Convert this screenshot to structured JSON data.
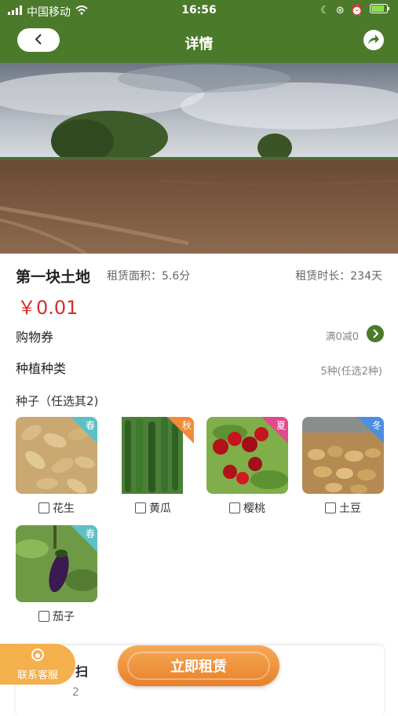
{
  "status_bar": {
    "carrier": "中国移动",
    "time": "16:56"
  },
  "nav": {
    "title": "详情",
    "back_icon": "chevron-left-icon",
    "share_icon": "share-icon"
  },
  "land": {
    "name": "第一块土地",
    "area_label": "租赁面积：5.6分",
    "duration_label": "租赁时长：234天",
    "price": "￥0.01"
  },
  "coupon": {
    "label": "购物券",
    "value": "满0减0"
  },
  "planting": {
    "label": "种植种类",
    "value": "5种(任选2种)"
  },
  "seeds": {
    "title": "种子（任选其2)",
    "items": [
      {
        "name": "花生",
        "season": "春",
        "season_color": "#5bc0c7",
        "image": "peanuts"
      },
      {
        "name": "黄瓜",
        "season": "秋",
        "season_color": "#f28a3a",
        "image": "cucumbers"
      },
      {
        "name": "樱桃",
        "season": "夏",
        "season_color": "#e04a8c",
        "image": "cherries"
      },
      {
        "name": "土豆",
        "season": "冬",
        "season_color": "#4c8fe0",
        "image": "potatoes"
      },
      {
        "name": "茄子",
        "season": "春",
        "season_color": "#5bc0c7",
        "image": "eggplant"
      }
    ]
  },
  "bottom": {
    "service_label": "联系客服",
    "rent_label": "立即租赁",
    "card_label": "扫",
    "card_count": "2"
  },
  "colors": {
    "brand": "#4b7a2a",
    "price": "#d32f2f",
    "accent": "#ef8f34"
  }
}
